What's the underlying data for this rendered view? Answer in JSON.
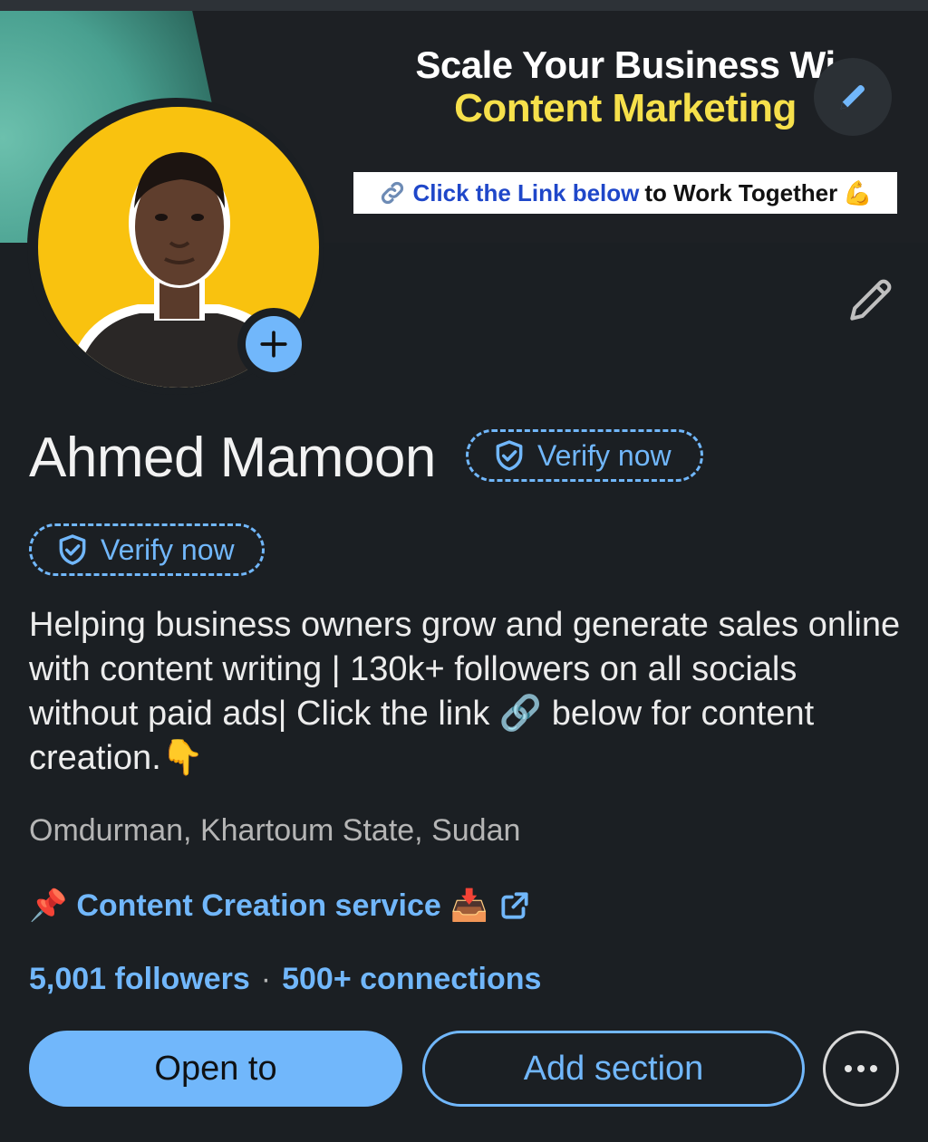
{
  "banner": {
    "line1": "Scale Your Business Wi",
    "line2": "Content Marketing",
    "strip_link_text": "Click the Link below",
    "strip_rest_text": "to Work Together",
    "strip_emoji": "💪",
    "edit_icon": "pencil-icon"
  },
  "profile": {
    "name": "Ahmed Mamoon",
    "verify_label": "Verify now",
    "headline": "Helping business owners grow and generate sales online with content writing | 130k+ followers on all socials without paid ads| Click the link 🔗 below for content creation.👇",
    "location": "Omdurman, Khartoum State, Sudan",
    "service_pin": "📌",
    "service_label": "Content Creation service",
    "service_emoji": "📥",
    "followers": "5,001 followers",
    "separator": "·",
    "connections": "500+ connections"
  },
  "actions": {
    "open_to": "Open to",
    "add_section": "Add section"
  },
  "colors": {
    "background": "#1b1f23",
    "accent": "#71b7fb",
    "avatar_bg": "#f9c20f",
    "banner_yellow": "#f6e04b"
  }
}
